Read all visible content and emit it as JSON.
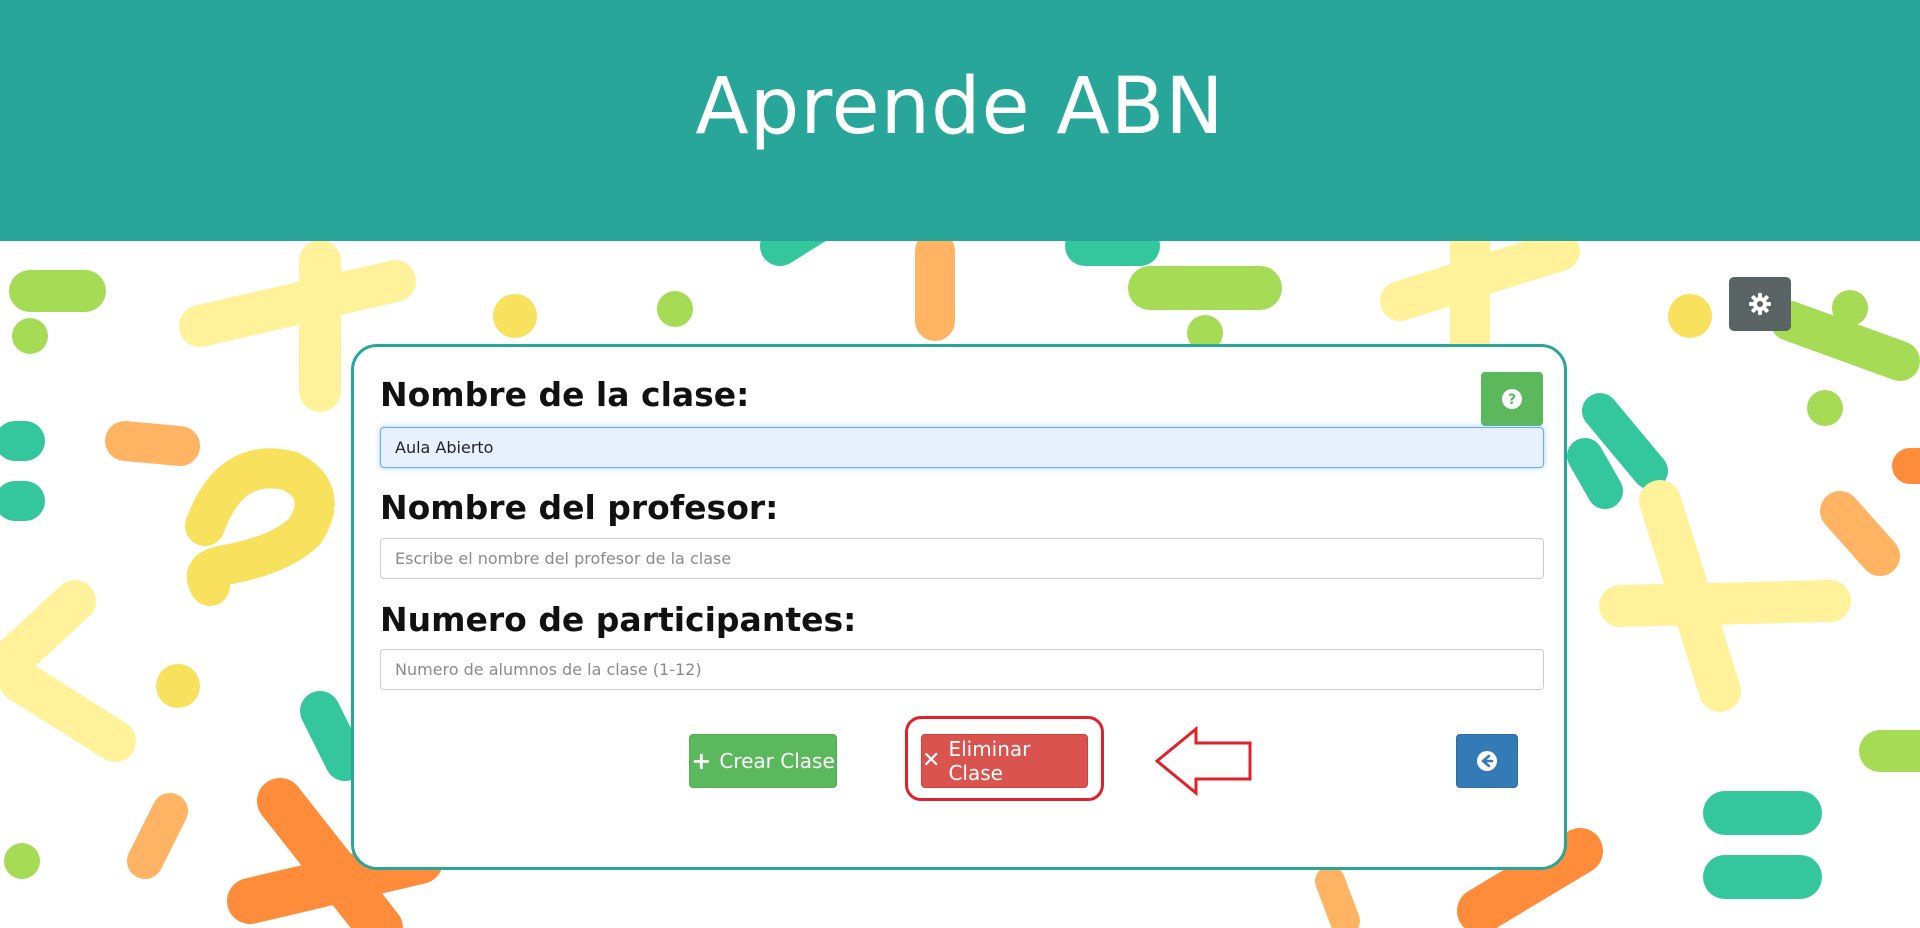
{
  "header": {
    "title": "Aprende ABN"
  },
  "form": {
    "class_name_label": "Nombre de la clase:",
    "class_name_value": "Aula Abierto",
    "teacher_label": "Nombre del profesor:",
    "teacher_placeholder": "Escribe el nombre del profesor de la clase",
    "participants_label": "Numero de participantes:",
    "participants_placeholder": "Numero de alumnos de la clase (1-12)"
  },
  "buttons": {
    "create_label": "Crear Clase",
    "delete_label": "Eliminar Clase",
    "help_icon": "question-circle-icon",
    "back_icon": "arrow-circle-left-icon",
    "settings_icon": "gear-icon"
  },
  "colors": {
    "header": "#29a69a",
    "create": "#5cb85c",
    "delete": "#d9534f",
    "back": "#337ab7",
    "settings": "#5a6464",
    "annotation": "#e0202a"
  }
}
